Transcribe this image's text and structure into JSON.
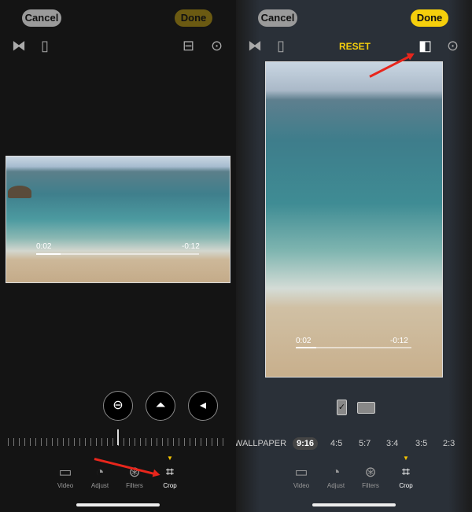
{
  "left": {
    "cancel": "Cancel",
    "done": "Done",
    "done_color": "#6b5a12",
    "time_elapsed": "0:02",
    "time_remaining": "-0:12",
    "progress": 0.15,
    "tools": [
      {
        "label": "Video",
        "icon": "video-icon"
      },
      {
        "label": "Adjust",
        "icon": "adjust-icon"
      },
      {
        "label": "Filters",
        "icon": "filters-icon"
      },
      {
        "label": "Crop",
        "icon": "crop-icon",
        "active": true
      }
    ]
  },
  "right": {
    "cancel": "Cancel",
    "done": "Done",
    "done_color": "#f5cf0c",
    "reset": "RESET",
    "time_elapsed": "0:02",
    "time_remaining": "-0:12",
    "progress": 0.18,
    "ratios": [
      "WALLPAPER",
      "9:16",
      "4:5",
      "5:7",
      "3:4",
      "3:5",
      "2:3"
    ],
    "selected_ratio": "9:16",
    "tools": [
      {
        "label": "Video",
        "icon": "video-icon"
      },
      {
        "label": "Adjust",
        "icon": "adjust-icon"
      },
      {
        "label": "Filters",
        "icon": "filters-icon"
      },
      {
        "label": "Crop",
        "icon": "crop-icon",
        "active": true
      }
    ]
  },
  "annotation_color": "#e8261c"
}
